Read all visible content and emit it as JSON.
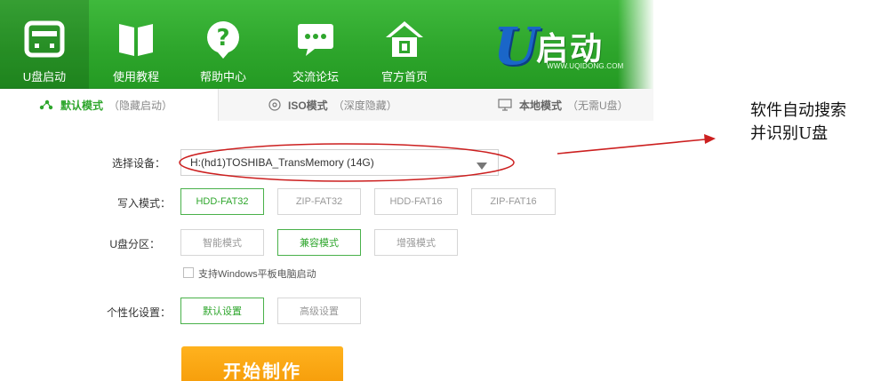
{
  "colors": {
    "brand_green": "#2ea62c",
    "accent_orange": "#f59a07",
    "logo_blue": "#1a66c8",
    "annotation_red": "#cc1f1f"
  },
  "nav": {
    "items": [
      {
        "label": "U盘启动",
        "icon": "usb-drive-icon",
        "active": true
      },
      {
        "label": "使用教程",
        "icon": "book-icon",
        "active": false
      },
      {
        "label": "帮助中心",
        "icon": "help-question-icon",
        "active": false
      },
      {
        "label": "交流论坛",
        "icon": "chat-bubble-icon",
        "active": false
      },
      {
        "label": "官方首页",
        "icon": "home-icon",
        "active": false
      }
    ]
  },
  "logo": {
    "mark": "U",
    "brand": "启动",
    "site": "WWW.UQIDONG.COM"
  },
  "tabs": [
    {
      "main": "默认模式",
      "sub": "（隐藏启动）",
      "icon": "share-icon",
      "active": true
    },
    {
      "main": "ISO模式",
      "sub": "（深度隐藏）",
      "icon": "disc-icon",
      "active": false
    },
    {
      "main": "本地模式",
      "sub": "（无需U盘）",
      "icon": "monitor-icon",
      "active": false
    }
  ],
  "form": {
    "device_label": "选择设备：",
    "device_value": "H:(hd1)TOSHIBA_TransMemory (14G)",
    "write_mode_label": "写入模式：",
    "write_modes": [
      {
        "label": "HDD-FAT32",
        "selected": true
      },
      {
        "label": "ZIP-FAT32",
        "selected": false
      },
      {
        "label": "HDD-FAT16",
        "selected": false
      },
      {
        "label": "ZIP-FAT16",
        "selected": false
      }
    ],
    "partition_label": "U盘分区：",
    "partitions": [
      {
        "label": "智能模式",
        "selected": false
      },
      {
        "label": "兼容模式",
        "selected": true
      },
      {
        "label": "增强模式",
        "selected": false
      }
    ],
    "tablet_checkbox_label": "支持Windows平板电脑启动",
    "tablet_checkbox_checked": false,
    "personalize_label": "个性化设置：",
    "personalize_options": [
      {
        "label": "默认设置",
        "selected": true
      },
      {
        "label": "高级设置",
        "selected": false
      }
    ],
    "start_button": "开始制作"
  },
  "annotation": {
    "line1": "软件自动搜索",
    "line2": "并识别U盘"
  }
}
